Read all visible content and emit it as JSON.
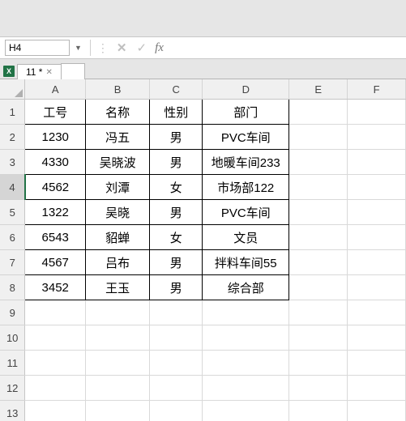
{
  "formula_bar": {
    "cell_ref": "H4",
    "fx_label": "fx",
    "formula_value": ""
  },
  "tab": {
    "name": "11 *"
  },
  "columns": [
    "A",
    "B",
    "C",
    "D",
    "E",
    "F"
  ],
  "rows": [
    "1",
    "2",
    "3",
    "4",
    "5",
    "6",
    "7",
    "8",
    "9",
    "10",
    "11",
    "12",
    "13"
  ],
  "selected_row": "4",
  "headers": {
    "a": "工号",
    "b": "名称",
    "c": "性别",
    "d": "部门"
  },
  "data": [
    {
      "a": "1230",
      "b": "冯五",
      "c": "男",
      "d": "PVC车间"
    },
    {
      "a": "4330",
      "b": "吴晓波",
      "c": "男",
      "d": "地暖车间233"
    },
    {
      "a": "4562",
      "b": "刘潭",
      "c": "女",
      "d": "市场部122"
    },
    {
      "a": "1322",
      "b": "吴晓",
      "c": "男",
      "d": "PVC车间"
    },
    {
      "a": "6543",
      "b": "貂蝉",
      "c": "女",
      "d": "文员"
    },
    {
      "a": "4567",
      "b": "吕布",
      "c": "男",
      "d": "拌料车间55"
    },
    {
      "a": "3452",
      "b": "王玉",
      "c": "男",
      "d": "综合部"
    }
  ]
}
